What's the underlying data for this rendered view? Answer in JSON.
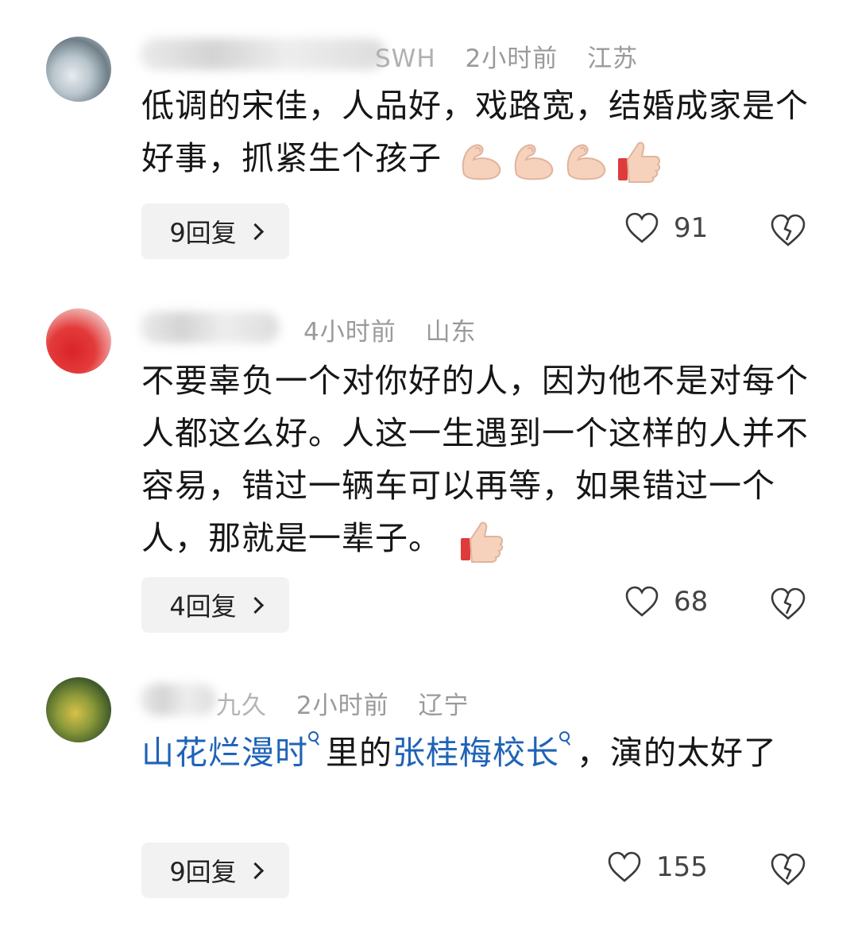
{
  "comments": [
    {
      "name_visible": "SWH",
      "time": "2小时前",
      "location": "江苏",
      "text": "低调的宋佳，人品好，戏路宽，结婚成家是个好事，抓紧生个孩子",
      "emojis": [
        "flexed-biceps-icon",
        "flexed-biceps-icon",
        "flexed-biceps-icon",
        "thumbs-up-icon"
      ],
      "reply_label": "9回复",
      "likes": "91"
    },
    {
      "name_visible": "",
      "time": "4小时前",
      "location": "山东",
      "text": "不要辜负一个对你好的人，因为他不是对每个人都这么好。人这一生遇到一个这样的人并不容易，错过一辆车可以再等，如果错过一个人，那就是一辈子。",
      "emojis": [
        "thumbs-up-icon"
      ],
      "reply_label": "4回复",
      "likes": "68"
    },
    {
      "name_visible": "九久",
      "time": "2小时前",
      "location": "辽宁",
      "link1": "山花烂漫时",
      "mid": "里的",
      "link2": "张桂梅校长",
      "tail": "，演的太好了",
      "reply_label": "9回复",
      "likes": "155"
    }
  ],
  "colors": {
    "link": "#1f63b7",
    "meta": "#9a9a9a",
    "button_bg": "#f2f2f2"
  }
}
